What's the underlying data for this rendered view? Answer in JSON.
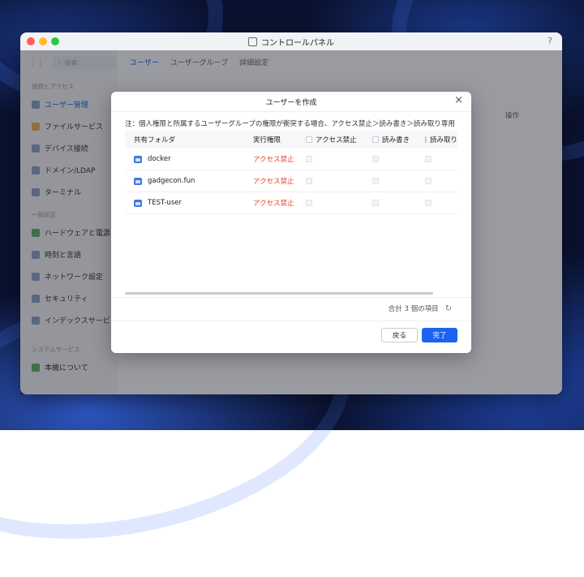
{
  "window": {
    "title": "コントロールパネル",
    "help": "?"
  },
  "sidebar": {
    "search_placeholder": "検索",
    "section1": "接続とアクセス",
    "items1": [
      "ユーザー管理",
      "ファイルサービス",
      "デバイス接続",
      "ドメイン/LDAP",
      "ターミナル"
    ],
    "section2": "一般設定",
    "items2": [
      "ハードウェアと電源",
      "時刻と言語",
      "ネットワーク設定",
      "セキュリティ",
      "インデックスサービス"
    ],
    "section3": "システムサービス",
    "items3": [
      "本機について"
    ]
  },
  "main": {
    "tabs": [
      "ユーザー",
      "ユーザーグループ",
      "詳細設定"
    ],
    "action_col": "操作"
  },
  "dialog": {
    "title": "ユーザーを作成",
    "note": "注：個人権限と所属するユーザーグループの権限が衝突する場合、アクセス禁止＞読み書き＞読み取り専用",
    "columns": {
      "folder": "共有フォルダ",
      "effective": "実行権限",
      "deny": "アクセス禁止",
      "rw": "読み書き",
      "ro": "読み取り専用"
    },
    "rows": [
      {
        "folder": "docker",
        "effective": "アクセス禁止"
      },
      {
        "folder": "gadgecon.fun",
        "effective": "アクセス禁止"
      },
      {
        "folder": "TEST-user",
        "effective": "アクセス禁止"
      }
    ],
    "total": "合計 3 個の項目",
    "back": "戻る",
    "done": "完了"
  }
}
